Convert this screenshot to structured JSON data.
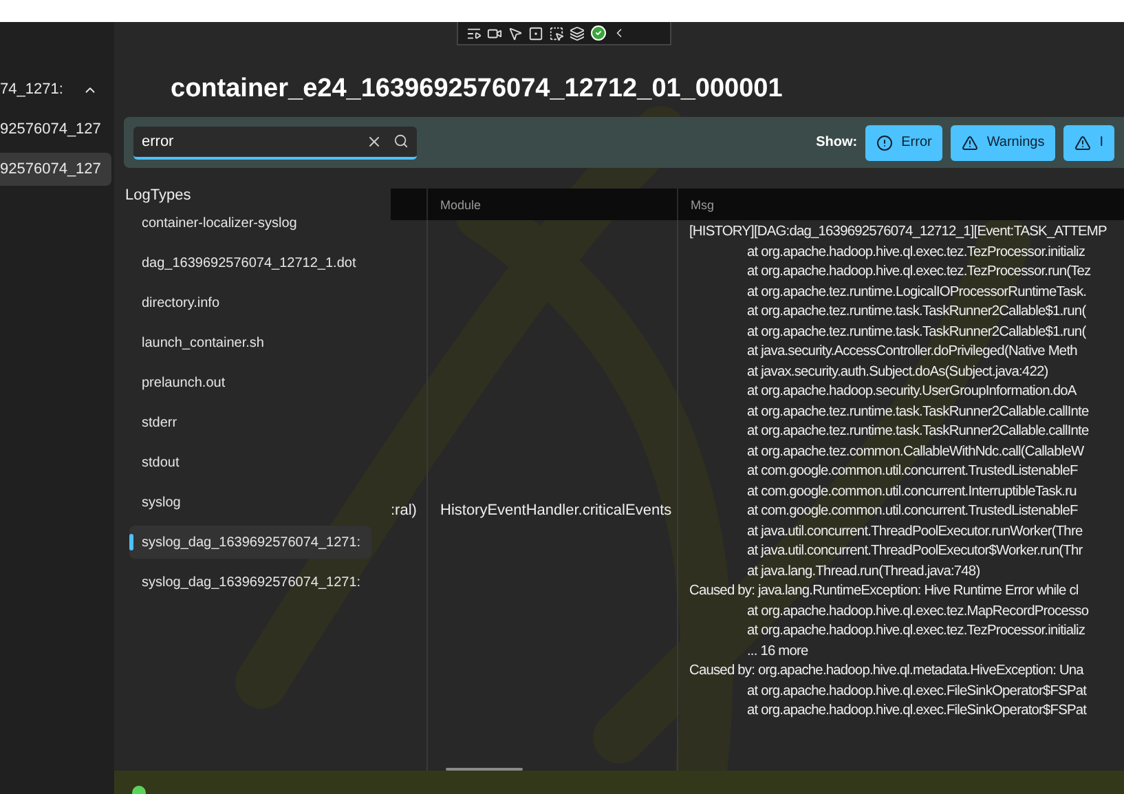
{
  "sidebar": {
    "items": [
      {
        "label": "74_1271:",
        "selected": false,
        "expanded": true
      },
      {
        "label": "92576074_127",
        "selected": false
      },
      {
        "label": "92576074_127",
        "selected": true
      }
    ]
  },
  "title": "container_e24_1639692576074_12712_01_000001",
  "search": {
    "value": "error"
  },
  "filters": {
    "label": "Show:",
    "buttons": [
      {
        "label": "Error",
        "kind": "error"
      },
      {
        "label": "Warnings",
        "kind": "warning"
      },
      {
        "label": "I",
        "kind": "warning"
      }
    ]
  },
  "log_types": {
    "heading": "LogTypes",
    "items": [
      {
        "label": "container-localizer-syslog",
        "selected": false
      },
      {
        "label": "dag_1639692576074_12712_1.dot",
        "selected": false
      },
      {
        "label": "directory.info",
        "selected": false
      },
      {
        "label": "launch_container.sh",
        "selected": false
      },
      {
        "label": "prelaunch.out",
        "selected": false
      },
      {
        "label": "stderr",
        "selected": false
      },
      {
        "label": "stdout",
        "selected": false
      },
      {
        "label": "syslog",
        "selected": false
      },
      {
        "label": "syslog_dag_1639692576074_1271:",
        "selected": true
      },
      {
        "label": "syslog_dag_1639692576074_1271:",
        "selected": false
      }
    ]
  },
  "table": {
    "columns": [
      "Module",
      "Msg"
    ],
    "row": {
      "column_1": ":ral)",
      "module": "HistoryEventHandler.criticalEvents",
      "msg": [
        {
          "text": "[HISTORY][DAG:dag_1639692576074_12712_1][Event:TASK_ATTEMP",
          "kind": "head"
        },
        {
          "text": "at org.apache.hadoop.hive.ql.exec.tez.TezProcessor.initializ",
          "kind": "frame"
        },
        {
          "text": "at org.apache.hadoop.hive.ql.exec.tez.TezProcessor.run(Tez",
          "kind": "frame"
        },
        {
          "text": "at org.apache.tez.runtime.LogicalIOProcessorRuntimeTask.",
          "kind": "frame"
        },
        {
          "text": "at org.apache.tez.runtime.task.TaskRunner2Callable$1.run(",
          "kind": "frame"
        },
        {
          "text": "at org.apache.tez.runtime.task.TaskRunner2Callable$1.run(",
          "kind": "frame"
        },
        {
          "text": "at java.security.AccessController.doPrivileged(Native Meth",
          "kind": "frame"
        },
        {
          "text": "at javax.security.auth.Subject.doAs(Subject.java:422)",
          "kind": "frame"
        },
        {
          "text": "at org.apache.hadoop.security.UserGroupInformation.doA",
          "kind": "frame"
        },
        {
          "text": "at org.apache.tez.runtime.task.TaskRunner2Callable.callInte",
          "kind": "frame"
        },
        {
          "text": "at org.apache.tez.runtime.task.TaskRunner2Callable.callInte",
          "kind": "frame"
        },
        {
          "text": "at org.apache.tez.common.CallableWithNdc.call(CallableW",
          "kind": "frame"
        },
        {
          "text": "at com.google.common.util.concurrent.TrustedListenableF",
          "kind": "frame"
        },
        {
          "text": "at com.google.common.util.concurrent.InterruptibleTask.ru",
          "kind": "frame"
        },
        {
          "text": "at com.google.common.util.concurrent.TrustedListenableF",
          "kind": "frame"
        },
        {
          "text": "at java.util.concurrent.ThreadPoolExecutor.runWorker(Thre",
          "kind": "frame"
        },
        {
          "text": "at java.util.concurrent.ThreadPoolExecutor$Worker.run(Thr",
          "kind": "frame"
        },
        {
          "text": "at java.lang.Thread.run(Thread.java:748)",
          "kind": "frame"
        },
        {
          "text": "Caused by: java.lang.RuntimeException: Hive Runtime Error while cl",
          "kind": "head"
        },
        {
          "text": "at org.apache.hadoop.hive.ql.exec.tez.MapRecordProcesso",
          "kind": "frame"
        },
        {
          "text": "at org.apache.hadoop.hive.ql.exec.tez.TezProcessor.initializ",
          "kind": "frame"
        },
        {
          "text": "... 16 more",
          "kind": "frame"
        },
        {
          "text": "Caused by: org.apache.hadoop.hive.ql.metadata.HiveException: Una",
          "kind": "head"
        },
        {
          "text": "at org.apache.hadoop.hive.ql.exec.FileSinkOperator$FSPat",
          "kind": "frame"
        },
        {
          "text": "at org.apache.hadoop.hive.ql.exec.FileSinkOperator$FSPat",
          "kind": "frame"
        }
      ]
    }
  },
  "status_bar": {
    "on": true
  }
}
